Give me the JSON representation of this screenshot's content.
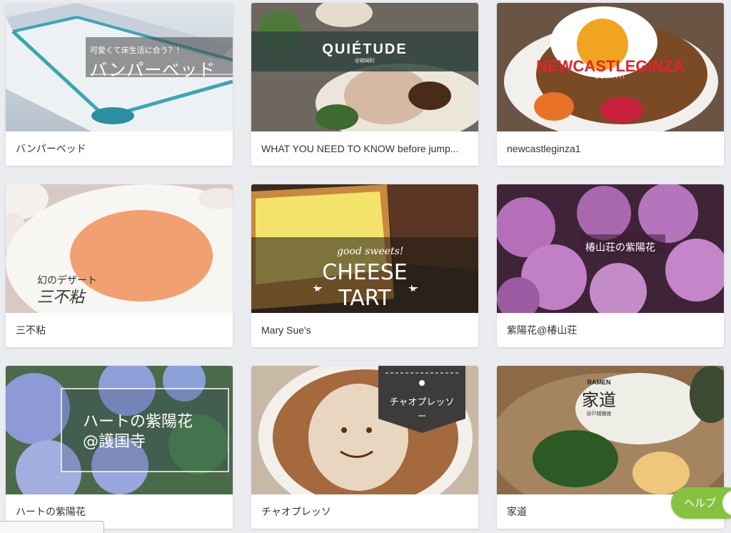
{
  "cards": [
    {
      "caption": "バンパーベッド",
      "overlay": {
        "line1": "可愛くて床生活に合う？！",
        "line2": "バンパーベッド"
      }
    },
    {
      "caption": "WHAT YOU NEED TO KNOW before jump...",
      "overlay": {
        "line1": "QUIÉTUDE",
        "line2": "@箱崎町"
      }
    },
    {
      "caption": "newcastleginza1",
      "overlay": {
        "line1": "NEWCASTLEGINZA",
        "line2": "CURRY!!"
      }
    },
    {
      "caption": "三不粘",
      "overlay": {
        "line1": "幻のデザート",
        "line2": "三不粘"
      }
    },
    {
      "caption": "Mary Sue's",
      "overlay": {
        "line1": "good sweets!",
        "line2": "CHEESE",
        "line3": "TART"
      }
    },
    {
      "caption": "紫陽花@椿山荘",
      "overlay": {
        "line1": "椿山荘の紫陽花"
      }
    },
    {
      "caption": "ハートの紫陽花",
      "overlay": {
        "line1": "ハートの紫陽花",
        "line2": "@護国寺"
      }
    },
    {
      "caption": "チャオプレッソ",
      "overlay": {
        "line1": "チャオプレッソ"
      }
    },
    {
      "caption": "家道",
      "overlay": {
        "line1": "RAMEN",
        "line2": "家道",
        "line3": "@戸越銀座"
      }
    }
  ],
  "help": {
    "label": "ヘルプ"
  },
  "colors": {
    "background": "#ebecef",
    "card": "#ffffff",
    "help_button": "#86c240",
    "newcastle_red": "#e5222a"
  }
}
